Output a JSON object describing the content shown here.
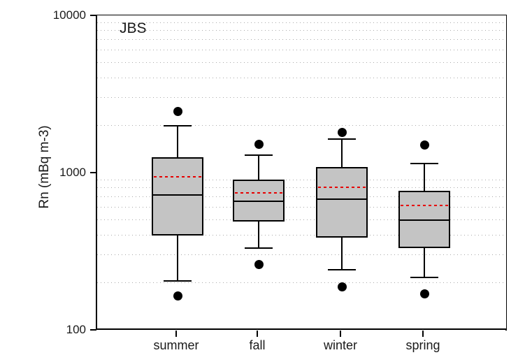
{
  "chart_data": {
    "type": "box",
    "title": "JBS",
    "xlabel": "",
    "ylabel": "Rn (mBq m-3)",
    "yscale": "log",
    "ylim": [
      100,
      10000
    ],
    "ytick_labels": [
      "10000",
      "1000",
      "100"
    ],
    "ytick_values": [
      10000,
      1000,
      100
    ],
    "grid": "horizontal minor log gridlines, dotted light gray",
    "legend": "none",
    "categories": [
      "summer",
      "fall",
      "winter",
      "spring"
    ],
    "boxes": [
      {
        "category": "summer",
        "whisker_high": 1990,
        "q3": 1250,
        "mean": 940,
        "median": 720,
        "q1": 400,
        "whisker_low": 205,
        "outliers": [
          2450,
          165
        ]
      },
      {
        "category": "fall",
        "whisker_high": 1290,
        "q3": 900,
        "mean": 740,
        "median": 660,
        "q1": 490,
        "whisker_low": 330,
        "outliers": [
          1510,
          260
        ]
      },
      {
        "category": "winter",
        "whisker_high": 1640,
        "q3": 1080,
        "mean": 810,
        "median": 680,
        "q1": 385,
        "whisker_low": 240,
        "outliers": [
          1800,
          188
        ]
      },
      {
        "category": "spring",
        "whisker_high": 1140,
        "q3": 770,
        "mean": 620,
        "median": 500,
        "q1": 330,
        "whisker_low": 215,
        "outliers": [
          1500,
          170
        ]
      }
    ],
    "minor_gridlines": [
      9000,
      8000,
      7000,
      6000,
      5000,
      4000,
      3000,
      2000,
      900,
      800,
      700,
      600,
      500,
      400,
      300,
      200
    ],
    "colors": {
      "box_fill": "#c4c4c4",
      "box_edge": "#000000",
      "median_line": "#000000",
      "mean_line": "#e60000",
      "outlier": "#000000",
      "grid": "#9a9a9a",
      "axis": "#000000",
      "background": "#ffffff"
    }
  }
}
